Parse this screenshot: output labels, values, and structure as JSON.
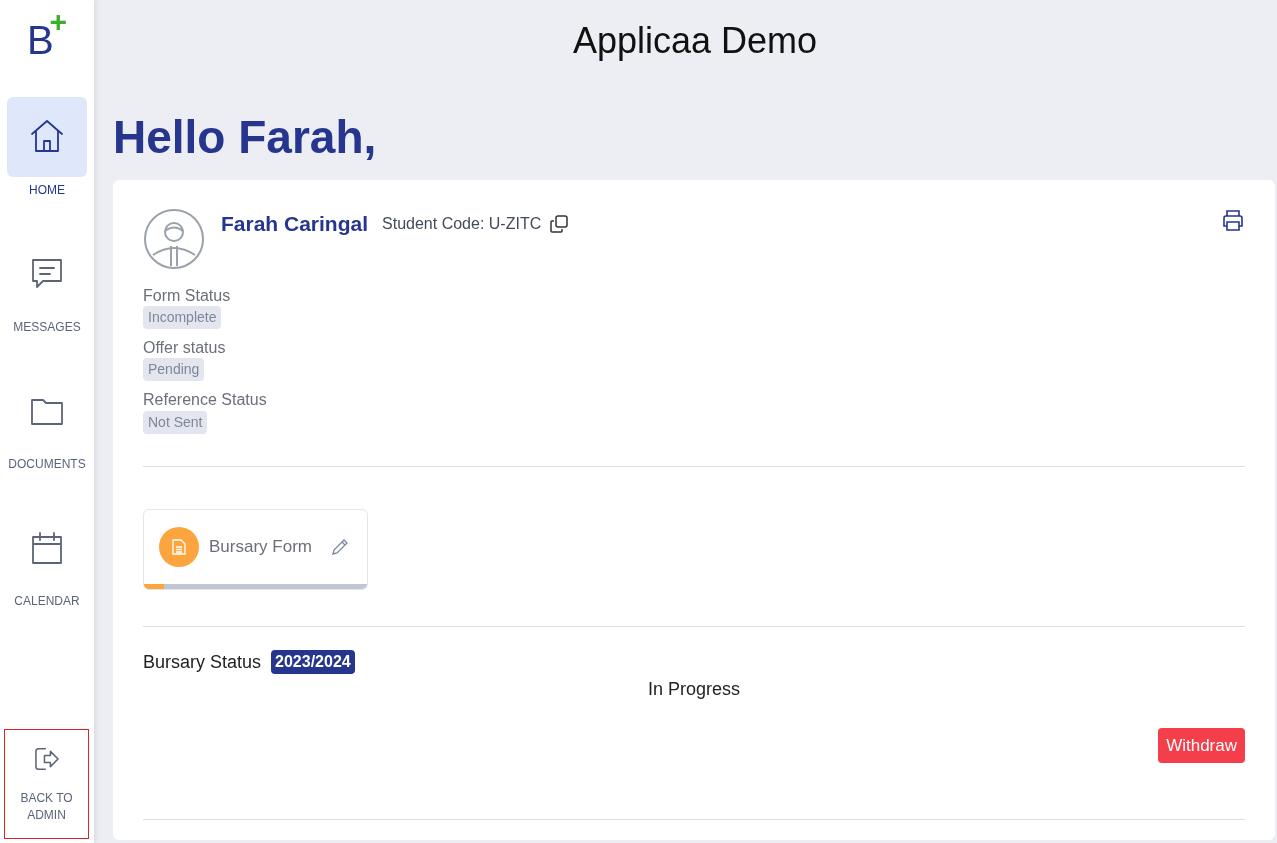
{
  "logo": {
    "letter": "B",
    "mark": "+"
  },
  "sidebar": {
    "items": [
      {
        "label": "HOME",
        "selected": true
      },
      {
        "label": "MESSAGES",
        "selected": false
      },
      {
        "label": "DOCUMENTS",
        "selected": false
      },
      {
        "label": "CALENDAR",
        "selected": false
      }
    ],
    "back": {
      "label": "BACK TO ADMIN",
      "outlined": true
    }
  },
  "header": {
    "title": "Applicaa Demo"
  },
  "greeting": "Hello Farah,",
  "profile": {
    "name": "Farah Caringal",
    "code": "Student Code: U-ZITC",
    "statuses": [
      {
        "label": "Form Status",
        "value": "Incomplete"
      },
      {
        "label": "Offer status",
        "value": "Pending"
      },
      {
        "label": "Reference Status",
        "value": "Not Sent"
      }
    ]
  },
  "forms": [
    {
      "title": "Bursary Form",
      "level": 0.09
    }
  ],
  "bursary": {
    "label": "Bursary Status",
    "year": "2023/2024",
    "state": "In Progress",
    "action": "Withdraw"
  }
}
